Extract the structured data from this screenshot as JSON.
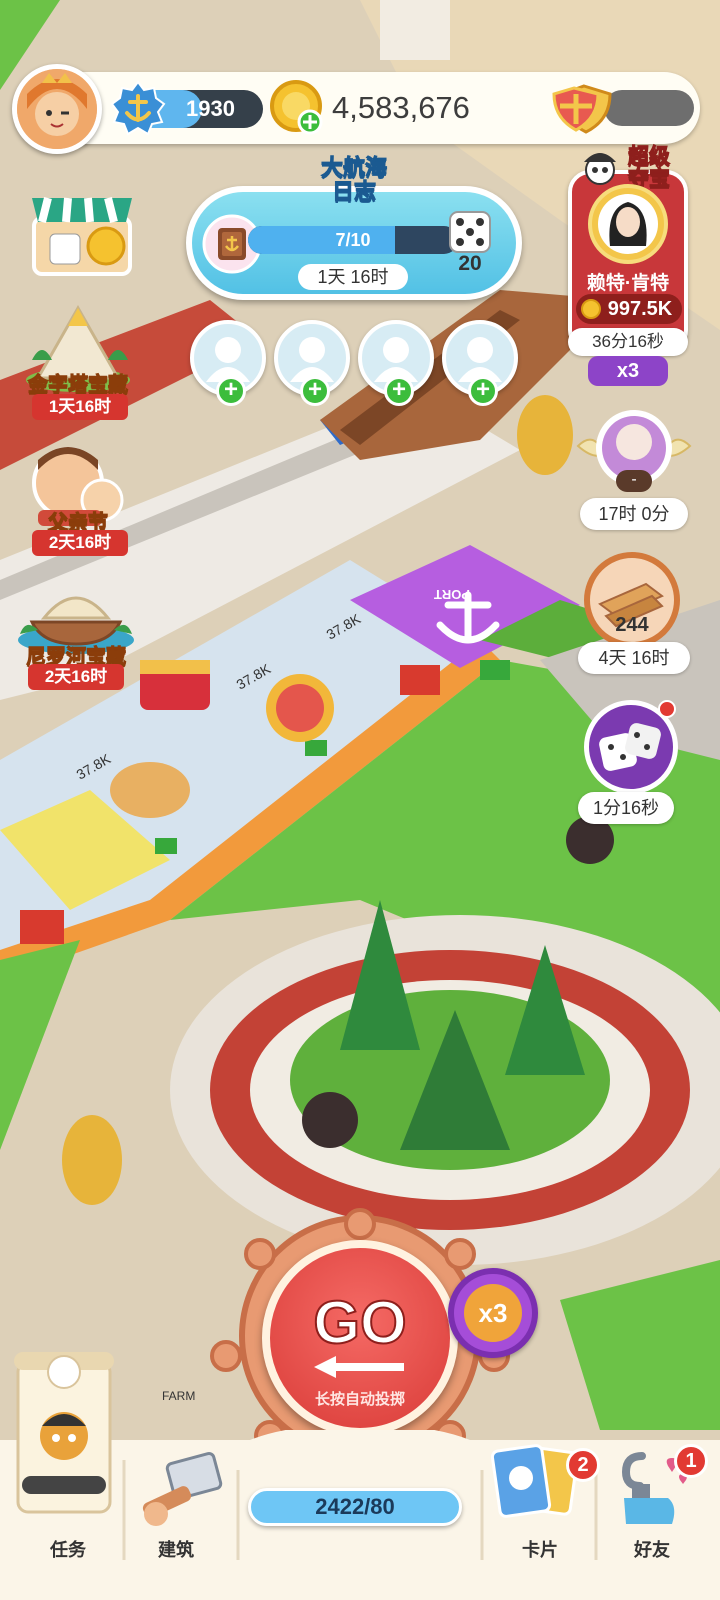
{
  "header": {
    "level_value": "1930",
    "level_progress": 0.55,
    "coins": "4,583,676"
  },
  "left_events": [
    {
      "title": "金字塔宝藏",
      "timer": "1天16时"
    },
    {
      "title": "父亲节",
      "timer": "2天16时"
    },
    {
      "title": "尼罗河宝藏",
      "timer": "2天16时"
    }
  ],
  "voyage_log": {
    "title_line1": "大航海",
    "title_line2": "日志",
    "progress_text": "7/10",
    "progress": 0.7,
    "dice_count": "20",
    "timer": "1天 16时"
  },
  "friends": {
    "slots": 4,
    "add_symbol": "+"
  },
  "super_heist": {
    "title_line1": "超级",
    "title_line2": "夺宝",
    "target_name": "赖特·肯特",
    "target_coins": "997.5K",
    "timer": "36分16秒",
    "multiplier": "x3"
  },
  "right_events": [
    {
      "name": "pearl",
      "value": "-",
      "timer": "17时 0分"
    },
    {
      "name": "wood",
      "value": "244",
      "timer": "4天 16时"
    },
    {
      "name": "dice",
      "timer": "1分16秒"
    }
  ],
  "board": {
    "port_label": "PORT",
    "tile_values": [
      "37.8K",
      "37.8K",
      "37.8K"
    ],
    "farm_label": "FARM"
  },
  "go_button": {
    "label": "GO",
    "sub_label": "长按自动投掷",
    "multiplier": "x3",
    "dice_counter": "2422/80"
  },
  "bottom_nav": [
    {
      "label": "任务",
      "badge": ""
    },
    {
      "label": "建筑",
      "badge": ""
    },
    {
      "label": "卡片",
      "badge": "2"
    },
    {
      "label": "好友",
      "badge": "1"
    }
  ],
  "colors": {
    "grass": "#6cc247",
    "path": "#d9cdb8",
    "port_purple": "#b65ee0",
    "go_red": "#e34b46",
    "accent_blue": "#5fb6ee"
  }
}
